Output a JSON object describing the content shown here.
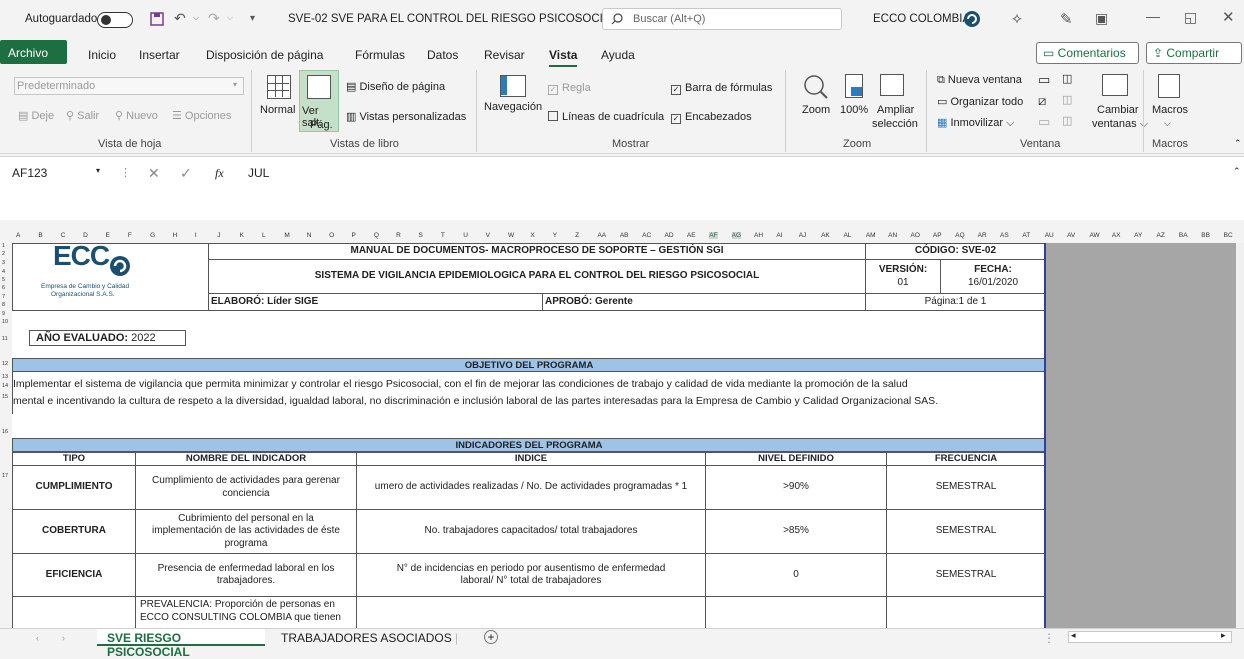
{
  "titlebar": {
    "autosave_label": "Autoguardado",
    "filename": "SVE-02 SVE PARA EL CONTROL DEL RIESGO PSICOSOCIAL",
    "filename_chevron": "⌵",
    "search_placeholder": "Buscar (Alt+Q)",
    "account": "ECCO COLOMBIA"
  },
  "menu": {
    "items": [
      "Archivo",
      "Inicio",
      "Insertar",
      "Disposición de página",
      "Fórmulas",
      "Datos",
      "Revisar",
      "Vista",
      "Ayuda"
    ],
    "comments": "Comentarios",
    "share": "Compartir"
  },
  "ribbon": {
    "sheet_view": {
      "dropdown_value": "Predeterminado",
      "keep": "Deje",
      "exit": "Salir",
      "new": "Nuevo",
      "options": "Opciones",
      "group_label": "Vista de hoja"
    },
    "workbook_views": {
      "normal": "Normal",
      "page_break_1": "Ver salt.",
      "page_break_2": "Pág.",
      "page_layout": "Diseño de página",
      "custom_views": "Vistas personalizadas",
      "group_label": "Vistas de libro"
    },
    "show": {
      "navigation": "Navegación",
      "ruler": "Regla",
      "formula_bar": "Barra de fórmulas",
      "gridlines": "Líneas de cuadrícula",
      "headings": "Encabezados",
      "group_label": "Mostrar"
    },
    "zoom": {
      "zoom": "Zoom",
      "percent": "100%",
      "zoom_sel_1": "Ampliar",
      "zoom_sel_2": "selección",
      "group_label": "Zoom"
    },
    "window": {
      "new_window": "Nueva ventana",
      "arrange_all": "Organizar todo",
      "freeze": "Inmovilizar",
      "switch_1": "Cambiar",
      "switch_2": "ventanas",
      "group_label": "Ventana"
    },
    "macros": {
      "label": "Macros",
      "group_label": "Macros"
    }
  },
  "formula_bar": {
    "name_box": "AF123",
    "fx": "fx",
    "content": "JUL"
  },
  "columns": [
    "A",
    "B",
    "C",
    "D",
    "E",
    "F",
    "G",
    "H",
    "I",
    "J",
    "K",
    "L",
    "M",
    "N",
    "O",
    "P",
    "Q",
    "R",
    "S",
    "T",
    "U",
    "V",
    "W",
    "X",
    "Y",
    "Z",
    "AA",
    "AB",
    "AC",
    "AD",
    "AE",
    "AF",
    "AG",
    "AH",
    "AI",
    "AJ",
    "AK",
    "AL",
    "AM",
    "AN",
    "AO",
    "AP",
    "AQ",
    "AR",
    "AS",
    "AT",
    "AU",
    "AV",
    "AW",
    "AX",
    "AY",
    "AZ",
    "BA",
    "BB",
    "BC"
  ],
  "rows": [
    "1",
    "2",
    "3",
    "4",
    "5",
    "6",
    "7",
    "8",
    "9",
    "10",
    "11",
    "12",
    "13",
    "14",
    "15",
    "16",
    "17"
  ],
  "document": {
    "logo_text": "ECC",
    "logo_sub1": "Empresa de Cambio y Calidad",
    "logo_sub2": "Organizacional S.A.S.",
    "manual_title": "MANUAL DE DOCUMENTOS- MACROPROCESO DE SOPORTE – GESTIÓN SGI",
    "code": "CÓDIGO: SVE-02",
    "system_title": "SISTEMA DE VIGILANCIA EPIDEMIOLOGICA PARA EL CONTROL DEL RIESGO PSICOSOCIAL",
    "version_label": "VERSIÓN:",
    "version": "01",
    "date_label": "FECHA:",
    "date": "16/01/2020",
    "prepared": "ELABORÓ: Líder SIGE",
    "approved": "APROBÓ: Gerente",
    "page": "Página:1 de 1",
    "year_label": "AÑO EVALUADO:",
    "year": "2022",
    "objective_header": "OBJETIVO DEL PROGRAMA",
    "objective_1": "Implementar el sistema de vigilancia que permita minimizar y controlar el riesgo Psicosocial, con el fin de mejorar las condiciones de trabajo y calidad de vida mediante la promoción de la salud",
    "objective_2": "mental e incentivando la cultura de respeto a la diversidad, igualdad laboral, no discriminación e inclusión laboral de las partes interesadas para la Empresa de Cambio y Calidad Organizacional SAS.",
    "indicators_header": "INDICADORES DEL PROGRAMA",
    "table_headers": [
      "TIPO",
      "NOMBRE DEL INDICADOR",
      "INDICE",
      "NIVEL DEFINIDO",
      "FRECUENCIA"
    ],
    "rows": [
      {
        "type": "CUMPLIMIENTO",
        "name": "Cumplimiento de  actividades para gerenar conciencia",
        "index": "umero de actividades realizadas / No. De actividades programadas * 1",
        "level": ">90%",
        "freq": "SEMESTRAL"
      },
      {
        "type": "COBERTURA",
        "name": "Cubrimiento del personal en la implementación de las actividades de éste programa",
        "index": "No. trabajadores capacitados/ total trabajadores",
        "level": ">85%",
        "freq": "SEMESTRAL"
      },
      {
        "type": "EFICIENCIA",
        "name": "Presencia de enfermedad laboral en los trabajadores.",
        "index": "N° de incidencias en periodo por ausentismo de enfermedad laboral/ N° total de trabajadores",
        "level": "0",
        "freq": "SEMESTRAL"
      },
      {
        "type": "",
        "name": "PREVALENCIA: Proporción de personas en ECCO CONSULTING COLOMBIA que tienen",
        "index": "",
        "level": "",
        "freq": ""
      }
    ]
  },
  "tabs": {
    "active": "SVE RIESGO PSICOSOCIAL",
    "other": "TRABAJADORES ASOCIADOS",
    "add": "+"
  },
  "colors": {
    "excel_green": "#1d6f42",
    "band_blue": "#9dc3e6",
    "sheet_gray": "#a6a6a6"
  }
}
